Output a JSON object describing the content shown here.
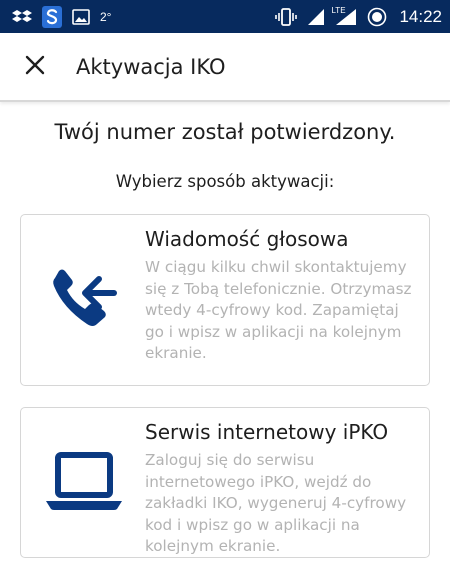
{
  "status_bar": {
    "temperature": "2°",
    "time": "14:22",
    "network_label": "LTE",
    "icons": [
      "dropbox-icon",
      "sync-icon",
      "gallery-icon",
      "vibrate-icon",
      "signal-icon",
      "lte-signal-icon",
      "data-saver-icon"
    ]
  },
  "app_bar": {
    "close_icon": "close-icon",
    "title": "Aktywacja IKO"
  },
  "content": {
    "headline": "Twój numer został potwierdzony.",
    "subhead": "Wybierz sposób aktywacji:"
  },
  "options": [
    {
      "icon": "incoming-call-icon",
      "title": "Wiadomość głosowa",
      "description": "W ciągu kilku chwil skontaktujemy się z Tobą telefonicznie. Otrzymasz wtedy 4-cyfrowy kod. Zapamiętaj go i wpisz w aplikacji na kolejnym ekranie."
    },
    {
      "icon": "laptop-icon",
      "title": "Serwis internetowy iPKO",
      "description": "Zaloguj się do serwisu internetowego iPKO, wejdź do zakładki IKO, wygeneruj 4-cyfrowy kod i wpisz go w aplikacji na kolejnym ekranie."
    }
  ],
  "colors": {
    "status_bar_bg": "#072a5e",
    "icon_blue": "#0b3a82",
    "text_dark": "#1e1e1e",
    "text_muted": "#b3b3b3"
  }
}
